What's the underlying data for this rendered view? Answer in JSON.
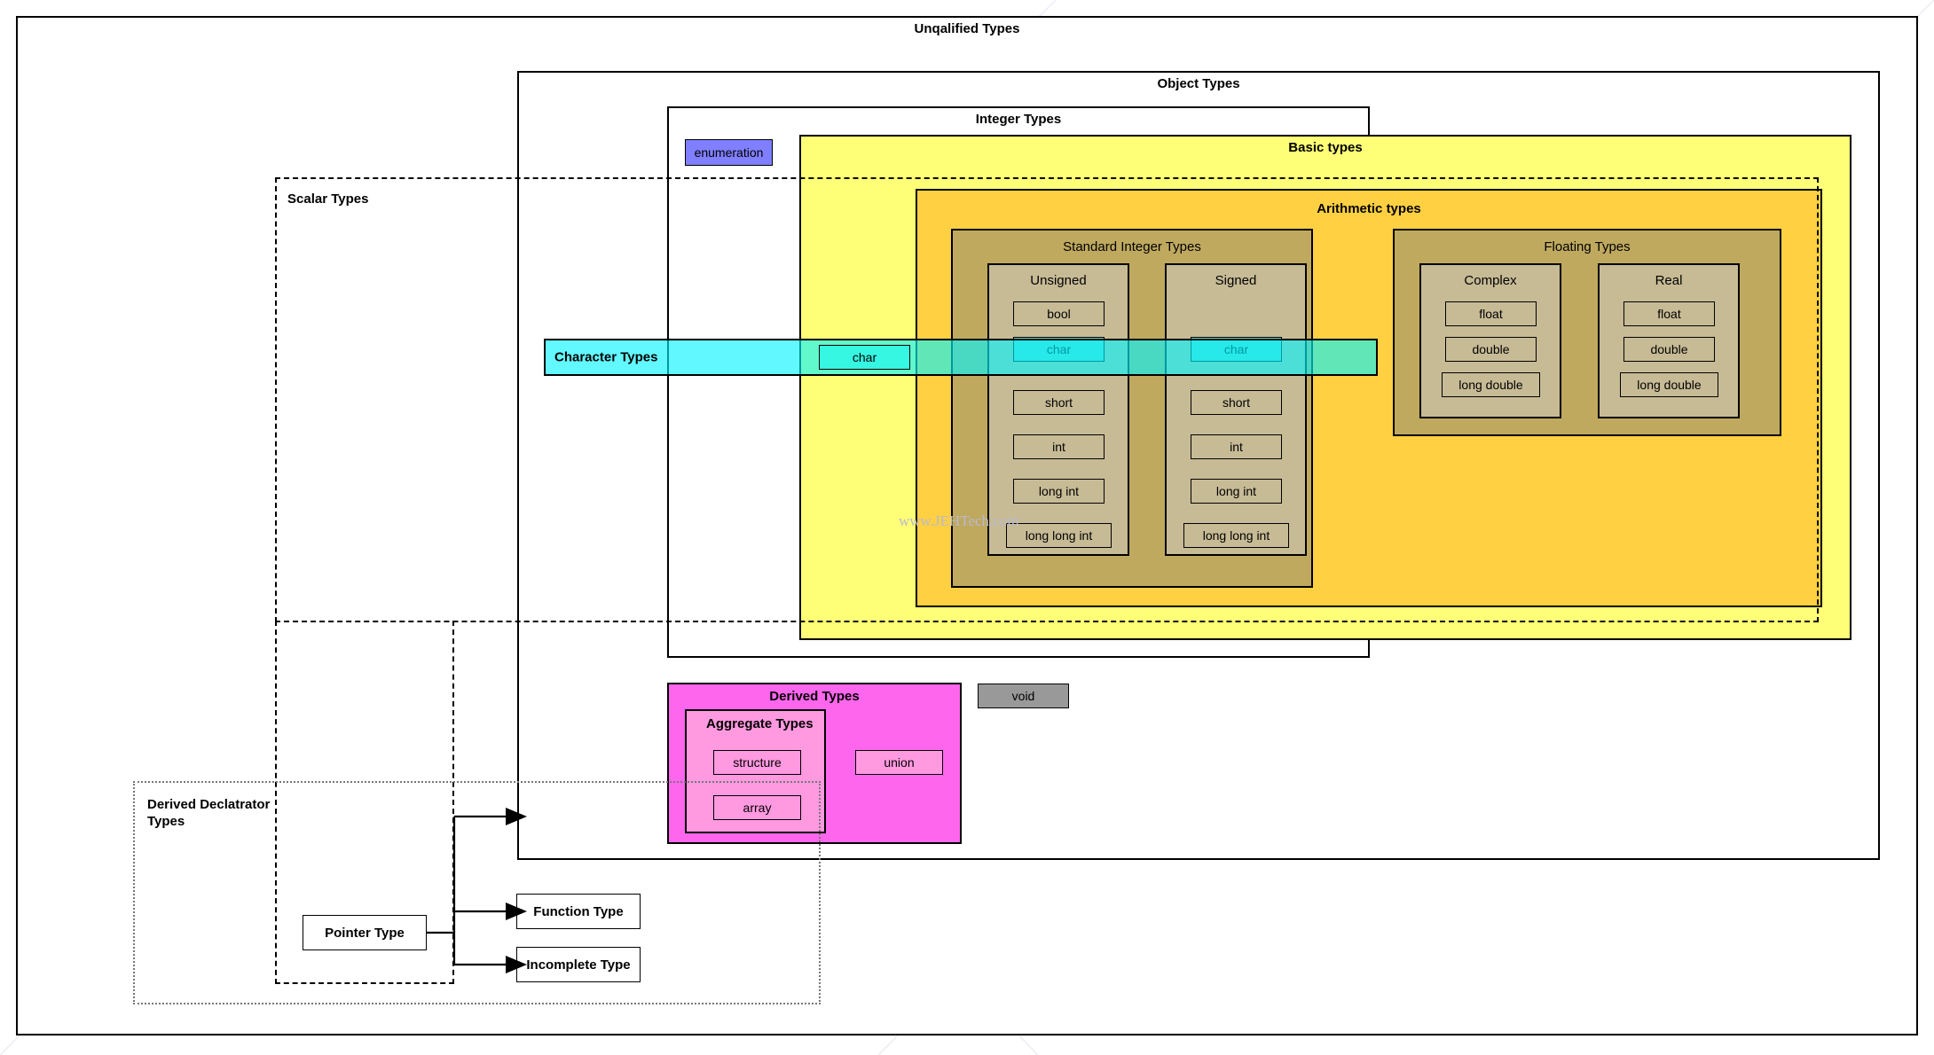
{
  "diagram": {
    "watermark": "www.JEHTech.com",
    "outer": {
      "label": "Unqalified Types"
    },
    "regions": {
      "object_types": {
        "label": "Object Types"
      },
      "integer_types": {
        "label": "Integer Types"
      },
      "basic_types": {
        "label": "Basic types"
      },
      "arithmetic_types": {
        "label": "Arithmetic types"
      },
      "standard_integer_types": {
        "label": "Standard Integer Types"
      },
      "floating_types": {
        "label": "Floating Types"
      },
      "scalar_types": {
        "label": "Scalar Types"
      },
      "character_types": {
        "label": "Character Types"
      },
      "derived_types": {
        "label": "Derived Types"
      },
      "aggregate_types": {
        "label": "Aggregate Types"
      },
      "derived_declarator_types": {
        "label": "Derived Declatrator\nTypes"
      },
      "unsigned": {
        "label": "Unsigned"
      },
      "signed": {
        "label": "Signed"
      },
      "complex": {
        "label": "Complex"
      },
      "real": {
        "label": "Real"
      }
    },
    "types": {
      "enumeration": "enumeration",
      "void": "void",
      "unsigned": {
        "bool": "bool",
        "char": "char",
        "short": "short",
        "int": "int",
        "long_int": "long int",
        "long_long_int": "long long int"
      },
      "signed": {
        "char": "char",
        "short": "short",
        "int": "int",
        "long_int": "long int",
        "long_long_int": "long long int"
      },
      "complex": {
        "float": "float",
        "double": "double",
        "long_double": "long double"
      },
      "real": {
        "float": "float",
        "double": "double",
        "long_double": "long double"
      },
      "character_char": "char",
      "structure": "structure",
      "union": "union",
      "array": "array",
      "pointer_type": "Pointer Type",
      "function_type": "Function Type",
      "incomplete_type": "Incomplete Type"
    },
    "colors": {
      "basic_types_fill": "#ffff77",
      "arithmetic_fill": "#ffd042",
      "integer_group_fill": "#bfa95f",
      "type_chip_fill": "#c7bb96",
      "character_band_fill": "#00f5ff",
      "derived_fill": "#ff66ee",
      "aggregate_fill": "#ff99e0",
      "void_fill": "#999999",
      "enumeration_fill": "#7f7fff"
    }
  }
}
